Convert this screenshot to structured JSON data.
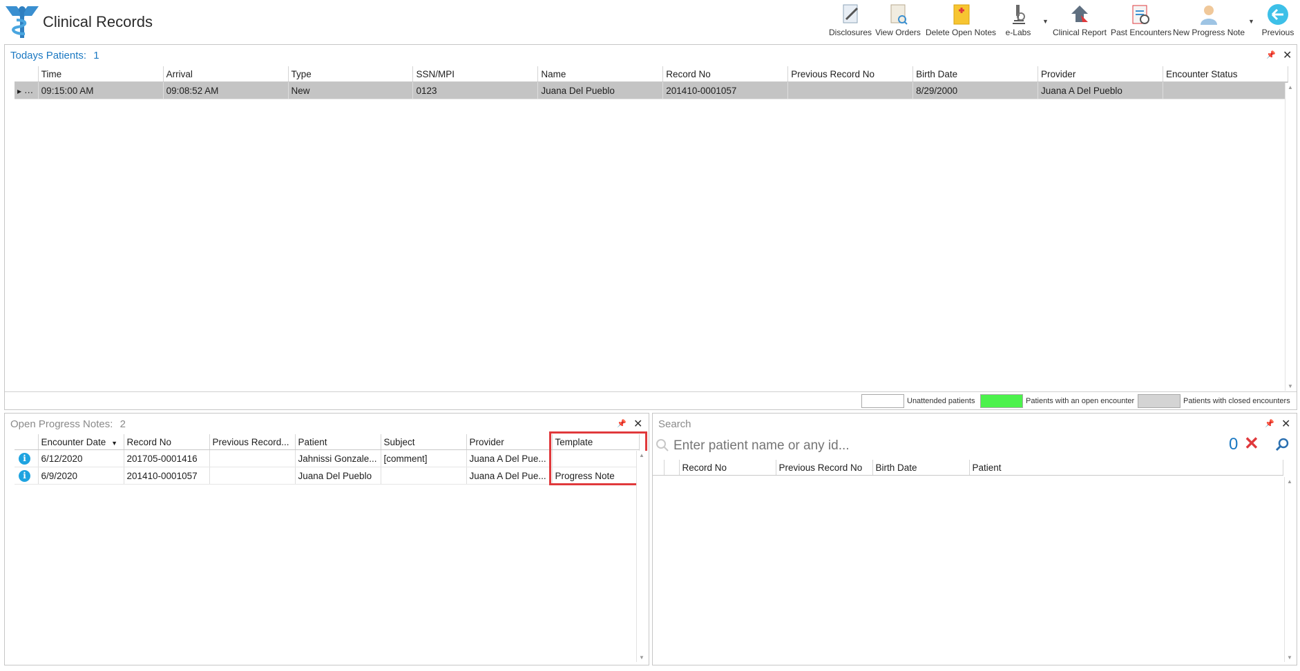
{
  "app": {
    "title": "Clinical Records"
  },
  "toolbar": {
    "disclosures": "Disclosures",
    "view_orders": "View Orders",
    "delete_open_notes": "Delete Open Notes",
    "elabs": "e-Labs",
    "clinical_report": "Clinical Report",
    "past_encounters": "Past Encounters",
    "new_progress_note": "New Progress Note",
    "previous": "Previous"
  },
  "todays_patients": {
    "title": "Todays Patients:",
    "count": "1",
    "columns": [
      "Time",
      "Arrival",
      "Type",
      "SSN/MPI",
      "Name",
      "Record No",
      "Previous Record No",
      "Birth Date",
      "Provider",
      "Encounter Status"
    ],
    "rows": [
      {
        "time": "09:15:00 AM",
        "arrival": "09:08:52 AM",
        "type": "New",
        "ssn": "0123",
        "name": "Juana Del Pueblo",
        "record_no": "201410-0001057",
        "prev_record": "",
        "birth_date": "8/29/2000",
        "provider": "Juana A Del Pueblo",
        "status": ""
      }
    ],
    "legend": {
      "unattended": "Unattended patients",
      "open": "Patients with an open encounter",
      "closed": "Patients with closed encounters",
      "colors": {
        "unattended": "#ffffff",
        "open": "#4cf24c",
        "closed": "#d4d4d4"
      }
    }
  },
  "open_notes": {
    "title": "Open Progress Notes:",
    "count": "2",
    "columns": [
      "Encounter Date",
      "Record No",
      "Previous Record...",
      "Patient",
      "Subject",
      "Provider",
      "Template"
    ],
    "rows": [
      {
        "date": "6/12/2020",
        "record_no": "201705-0001416",
        "prev_record": "",
        "patient": "Jahnissi Gonzale...",
        "subject": "[comment]",
        "provider": "Juana A Del Pue...",
        "template": ""
      },
      {
        "date": "6/9/2020",
        "record_no": "201410-0001057",
        "prev_record": "",
        "patient": "Juana Del Pueblo",
        "subject": "",
        "provider": "Juana A Del Pue...",
        "template": "Progress Note"
      }
    ]
  },
  "search": {
    "title": "Search",
    "placeholder": "Enter patient name or any id...",
    "count": "0",
    "columns": [
      "Record No",
      "Previous Record No",
      "Birth Date",
      "Patient"
    ]
  },
  "colors": {
    "accent": "#1a78c2",
    "selected_row": "#c4c4c4",
    "highlight": "#e0393c"
  }
}
